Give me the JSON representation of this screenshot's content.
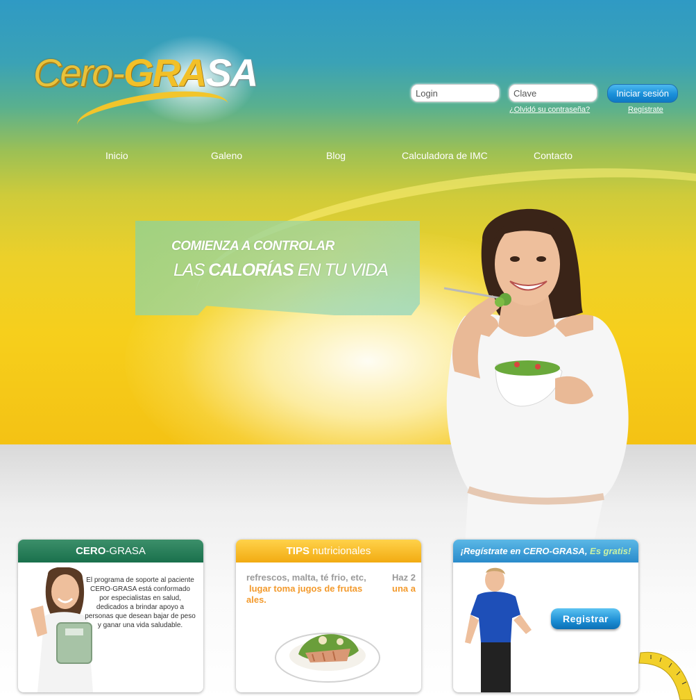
{
  "brand": {
    "logo_part1": "Cero-",
    "logo_part2": "GRA",
    "logo_part3": "SA"
  },
  "login": {
    "user_placeholder": "Login",
    "password_placeholder": "Clave",
    "submit_label": "Iniciar sesión",
    "forgot_link": "¿Olvidó su contraseña?",
    "register_link": "Regístrate"
  },
  "nav": {
    "items": [
      {
        "label": "Inicio"
      },
      {
        "label": "Galeno"
      },
      {
        "label": "Blog"
      },
      {
        "label": "Calculadora de IMC"
      },
      {
        "label": "Contacto"
      }
    ]
  },
  "hero": {
    "line1": "COMIENZA A CONTROLAR",
    "line2_a": "LAS",
    "line2_b": "CALORÍAS",
    "line2_c": "EN TU VIDA"
  },
  "cards": {
    "about": {
      "title_a": "CERO",
      "title_b": "-GRASA",
      "text": "El programa de soporte al paciente CERO-GRASA está conformado por especialistas en salud, dedicados a brindar apoyo a personas que desean bajar de peso y ganar una vida saludable."
    },
    "tips": {
      "title_a": "TIPS",
      "title_b": " nutricionales",
      "line1": "refrescos, malta, té frio, etc,",
      "line1_b": "Haz 2",
      "line2": "lugar toma jugos de frutas",
      "line2_b": "una a",
      "line3": "ales."
    },
    "register": {
      "title_a": "¡Regístrate en CERO-GRASA,",
      "title_b": " Es gratis!",
      "button_label": "Registrar"
    }
  },
  "colors": {
    "login_button": "#1a8fd9",
    "card_green": "#19704c",
    "card_yellow": "#f2ab12",
    "card_blue": "#2a8bcb",
    "tips_grey": "#9a9a9a",
    "tips_orange": "#f39a2c"
  }
}
